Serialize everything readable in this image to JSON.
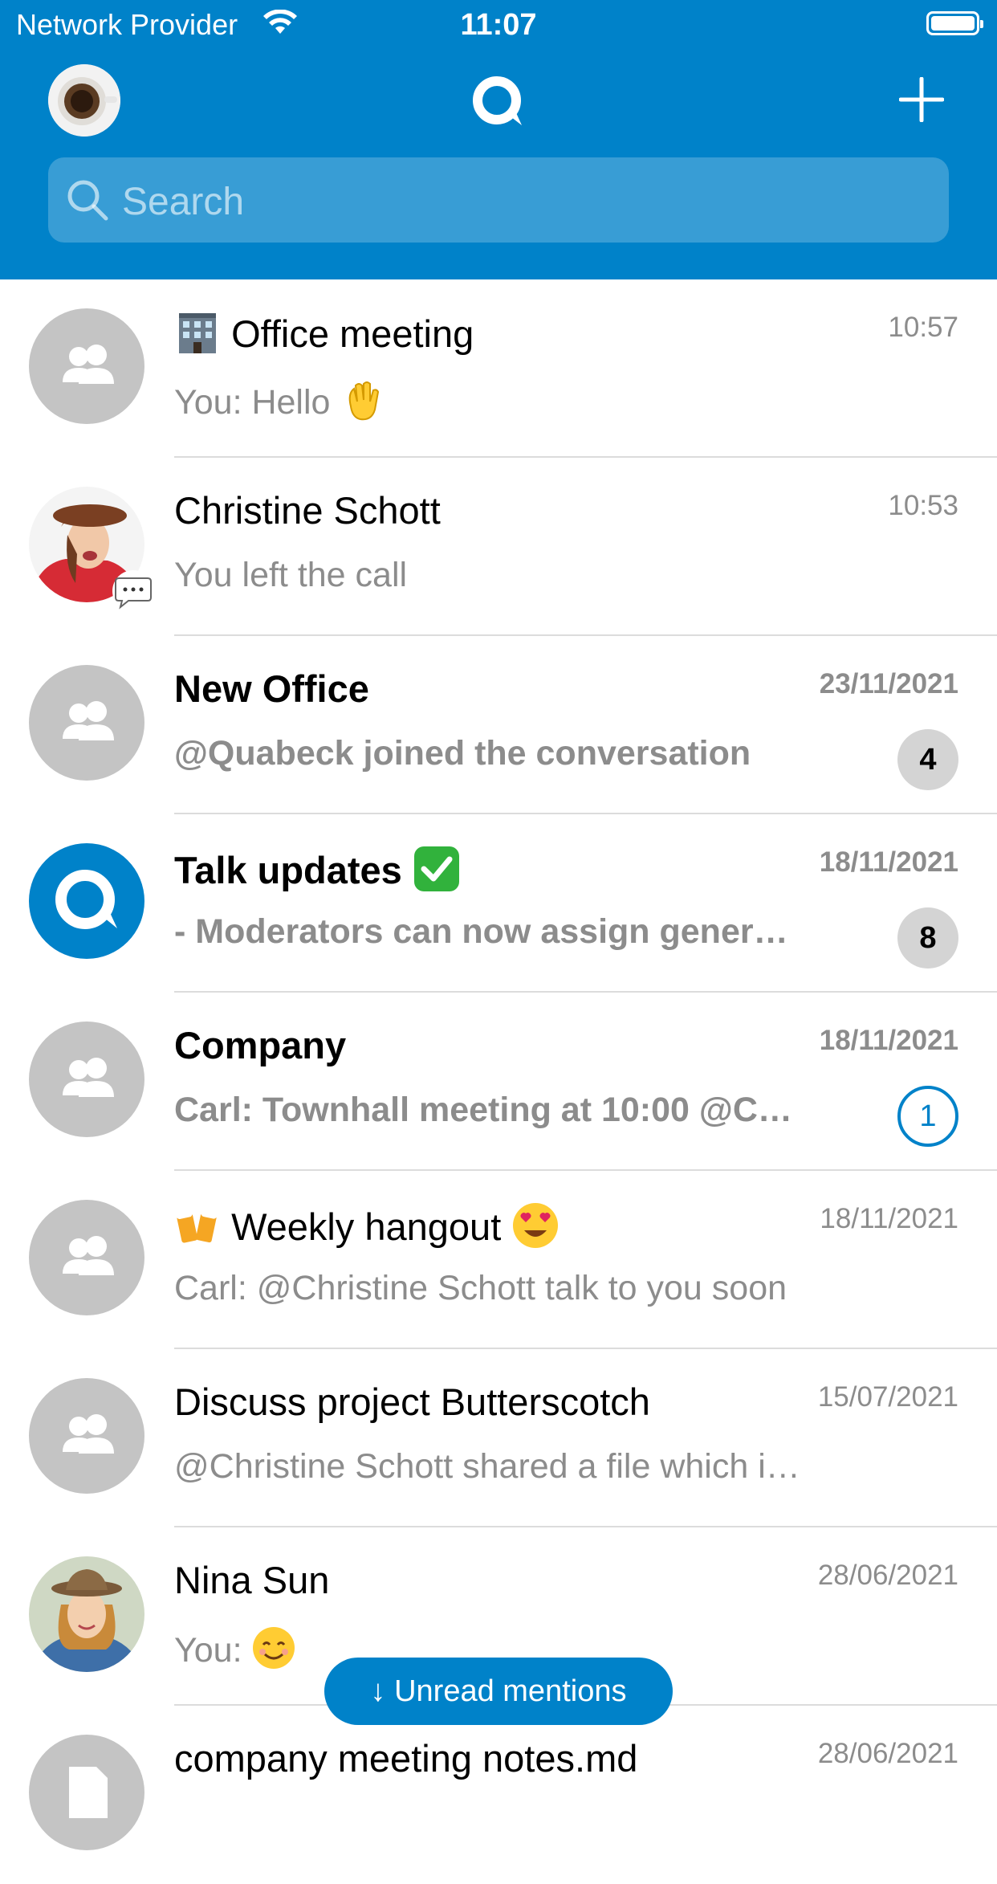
{
  "status_bar": {
    "carrier": "Network Provider",
    "time": "11:07"
  },
  "header": {
    "search_placeholder": "Search"
  },
  "conversations": [
    {
      "title": "Office meeting",
      "preview": "You: Hello",
      "date": "10:57"
    },
    {
      "title": "Christine Schott",
      "preview": "You left the call",
      "date": "10:53"
    },
    {
      "title": "New Office",
      "preview": "@Quabeck joined the conversation",
      "date": "23/11/2021",
      "unread": "4"
    },
    {
      "title": "Talk updates",
      "preview": "- Moderators can now assign gener…",
      "date": "18/11/2021",
      "unread": "8"
    },
    {
      "title": "Company",
      "preview": "Carl: Townhall meeting at 10:00 @C…",
      "date": "18/11/2021",
      "unread": "1"
    },
    {
      "title": "Weekly hangout",
      "preview": "Carl: @Christine Schott talk to you soon",
      "date": "18/11/2021"
    },
    {
      "title": "Discuss project Butterscotch",
      "preview": "@Christine Schott shared a file which i…",
      "date": "15/07/2021"
    },
    {
      "title": "Nina Sun",
      "preview": "You:",
      "date": "28/06/2021"
    },
    {
      "title": "company meeting notes.md",
      "preview": "",
      "date": "28/06/2021"
    }
  ],
  "unread_mentions_label": "↓ Unread mentions",
  "colors": {
    "brand": "#0082c9",
    "muted": "#8c8c8c",
    "avatar_grey": "#c4c4c4"
  }
}
